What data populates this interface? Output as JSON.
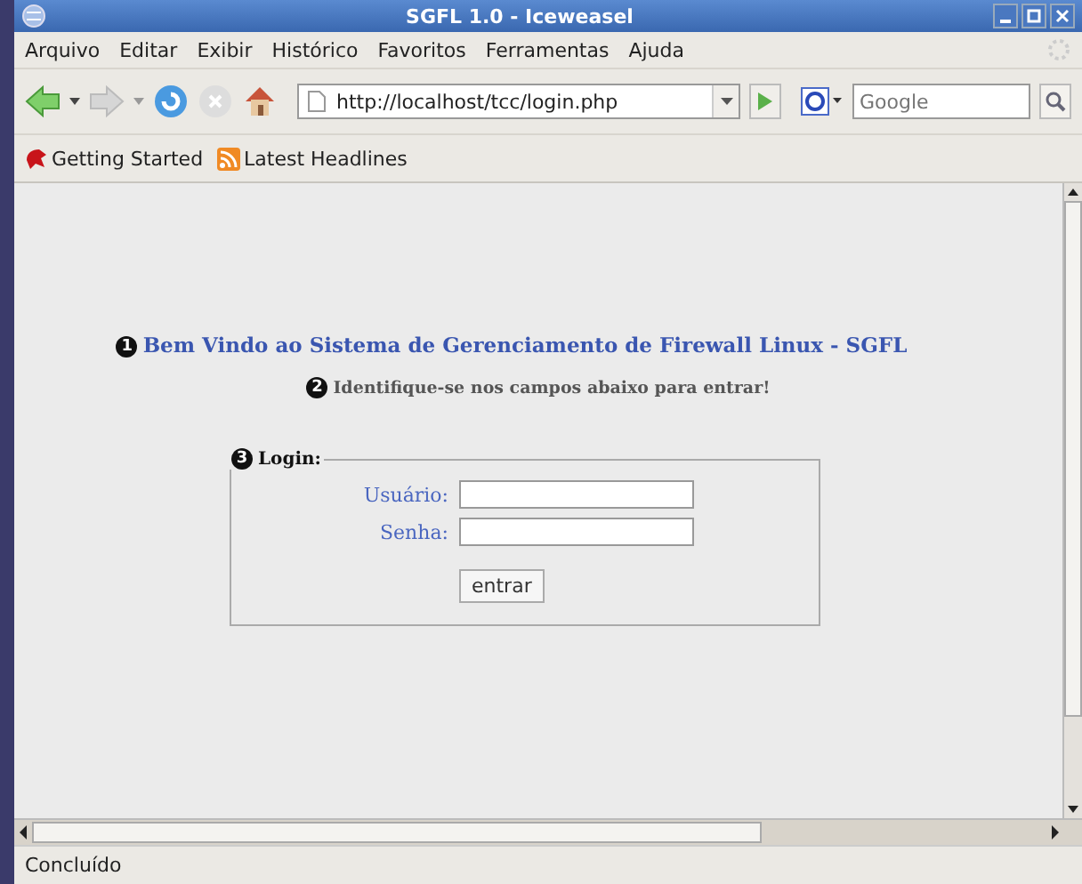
{
  "window": {
    "title": "SGFL 1.0 - Iceweasel"
  },
  "menu": [
    "Arquivo",
    "Editar",
    "Exibir",
    "Histórico",
    "Favoritos",
    "Ferramentas",
    "Ajuda"
  ],
  "toolbar": {
    "url": "http://localhost/tcc/login.php",
    "search_placeholder": "Google"
  },
  "bookmarks": [
    {
      "label": "Getting Started",
      "kind": "start"
    },
    {
      "label": "Latest Headlines",
      "kind": "feed"
    }
  ],
  "page": {
    "heading": {
      "marker": "1",
      "text": "Bem Vindo ao Sistema de Gerenciamento de Firewall Linux - SGFL"
    },
    "subheading": {
      "marker": "2",
      "text": "Identifique-se nos campos abaixo para entrar!"
    },
    "login": {
      "marker": "3",
      "legend": "Login:",
      "fields": [
        {
          "label": "Usuário:"
        },
        {
          "label": "Senha:"
        }
      ],
      "button": "entrar"
    }
  },
  "status_bar": "Concluído"
}
